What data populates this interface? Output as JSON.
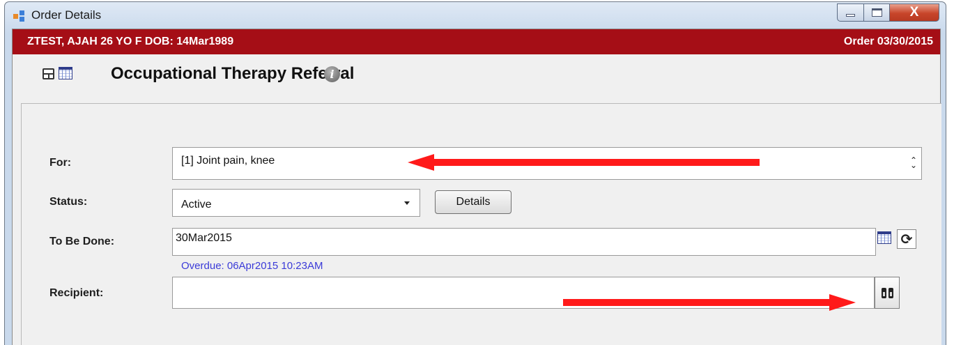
{
  "window": {
    "title": "Order Details",
    "close_glyph": "X",
    "icon": "app-window-icon"
  },
  "patient_band": {
    "patient_info": "ZTEST, AJAH  26 YO  F DOB: 14Mar1989",
    "order_date": "Order  03/30/2015",
    "background": "#a50e16"
  },
  "order": {
    "title": "Occupational Therapy Referral",
    "info_glyph": "i"
  },
  "form": {
    "for": {
      "label": "For:",
      "value": "[1] Joint pain, knee"
    },
    "status": {
      "label": "Status:",
      "value": "Active",
      "details_label": "Details"
    },
    "to_be_done": {
      "label": "To Be Done:",
      "value": "30Mar2015",
      "overdue": "Overdue: 06Apr2015 10:23AM",
      "refresh_glyph": "⟳"
    },
    "recipient": {
      "label": "Recipient:",
      "value": ""
    }
  },
  "annotations": {
    "arrow_color": "#ff1a1a"
  }
}
